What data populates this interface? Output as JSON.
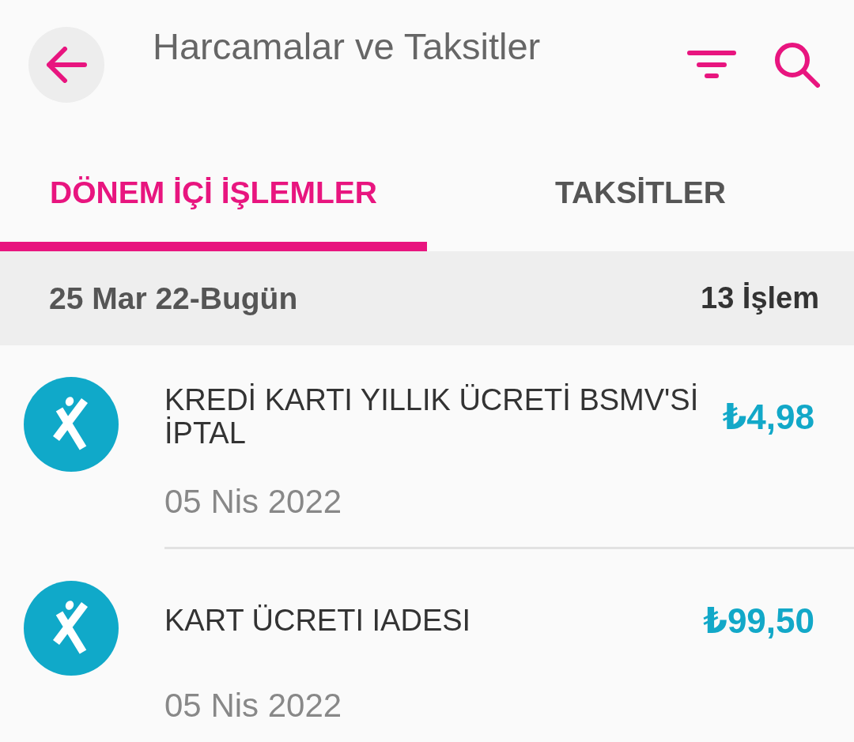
{
  "header": {
    "title": "Harcamalar ve Taksitler"
  },
  "tabs": [
    {
      "label": "DÖNEM İÇİ İŞLEMLER",
      "selected": true
    },
    {
      "label": "TAKSİTLER",
      "selected": false
    }
  ],
  "period": {
    "range": "25 Mar 22-Bugün",
    "count": "13 İşlem"
  },
  "transactions": [
    {
      "title": "KREDİ KARTI YILLIK ÜCRETİ BSMV'Sİ İPTAL",
      "amount": "₺4,98",
      "date": "05 Nis 2022"
    },
    {
      "title": "KART ÜCRETI IADESI",
      "amount": "₺99,50",
      "date": "05 Nis 2022"
    }
  ]
}
